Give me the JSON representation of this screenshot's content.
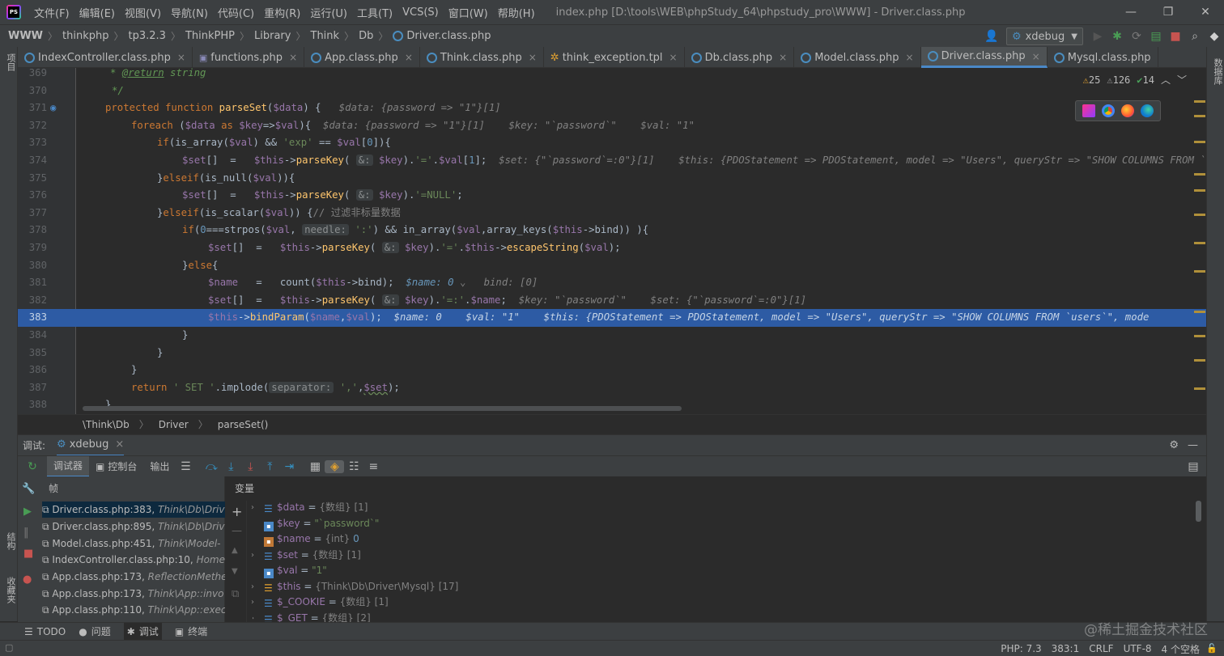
{
  "menubar": {
    "items": [
      "文件(F)",
      "编辑(E)",
      "视图(V)",
      "导航(N)",
      "代码(C)",
      "重构(R)",
      "运行(U)",
      "工具(T)",
      "VCS(S)",
      "窗口(W)",
      "帮助(H)"
    ],
    "window_title": "index.php [D:\\tools\\WEB\\phpStudy_64\\phpstudy_pro\\WWW] - Driver.class.php"
  },
  "navbar": {
    "breadcrumbs": [
      "WWW",
      "thinkphp",
      "tp3.2.3",
      "ThinkPHP",
      "Library",
      "Think",
      "Db",
      "Driver.class.php"
    ],
    "run_config": "xdebug"
  },
  "left_strip": {
    "project": "项目",
    "structure": "结构",
    "favorites": "收藏夹"
  },
  "right_strip": {
    "database": "数据库"
  },
  "tabs": [
    {
      "label": "IndexController.class.php"
    },
    {
      "label": "functions.php"
    },
    {
      "label": "App.class.php"
    },
    {
      "label": "Think.class.php"
    },
    {
      "label": "think_exception.tpl"
    },
    {
      "label": "Db.class.php"
    },
    {
      "label": "Model.class.php"
    },
    {
      "label": "Driver.class.php",
      "active": true
    },
    {
      "label": "Mysql.class.php"
    }
  ],
  "inspections": {
    "warnings": "25",
    "weak_warnings": "126",
    "typos": "14"
  },
  "code": {
    "lines": [
      {
        "num": "369"
      },
      {
        "num": "370"
      },
      {
        "num": "371"
      },
      {
        "num": "372"
      },
      {
        "num": "373"
      },
      {
        "num": "374"
      },
      {
        "num": "375"
      },
      {
        "num": "376"
      },
      {
        "num": "377"
      },
      {
        "num": "378"
      },
      {
        "num": "379"
      },
      {
        "num": "380"
      },
      {
        "num": "381"
      },
      {
        "num": "382"
      },
      {
        "num": "383"
      },
      {
        "num": "384"
      },
      {
        "num": "385"
      },
      {
        "num": "386"
      },
      {
        "num": "387"
      },
      {
        "num": "388"
      }
    ],
    "text": {
      "l369_a": "* ",
      "l369_b": "@return",
      " l369_c": " string",
      "l370": "*/",
      "l371_kw": "protected function ",
      "l371_fn": "parseSet",
      "l371_a": "(",
      "l371_v": "$data",
      "l371_b": ") {",
      "l371_h": "$data: {password => \"1\"}[1]",
      "l372_kw": "foreach ",
      "l372_a": "(",
      "l372_v1": "$data ",
      "l372_as": "as ",
      "l372_v2": "$key",
      "l372_b": "=>",
      "l372_v3": "$val",
      "l372_c": "){",
      "l372_h": "$data: {password => \"1\"}[1]    $key: \"`password`\"    $val: \"1\"",
      "l373_kw": "if",
      "l373_a": "(is_array(",
      "l373_v": "$val",
      "l373_b": ") && ",
      "l373_s": "'exp'",
      "l373_c": " == ",
      "l373_v2": "$val",
      "l373_d": "[",
      "l373_n": "0",
      "l373_e": "]){",
      "l374_v": "$set",
      "l374_a": "[]  =   ",
      "l374_v2": "$this",
      "l374_b": "->",
      "l374_fn": "parseKey",
      "l374_c": "( ",
      "l374_inlay": "&:",
      "l374_v3": "$key",
      ".": ".",
      "l374_d": ").",
      "l374_s": "'='",
      ".2": ".",
      "l374_v4": "$val",
      "l374_e": "[",
      "l374_n": "1",
      "l374_f": "];",
      "l374_h": "$set: {\"`password`=:0\"}[1]    $this: {PDOStatement => PDOStatement, model => \"Users\", queryStr => \"SHOW COLUMNS FROM `users`\", mode",
      "l375_a": "}",
      "l375_kw": "elseif",
      "l375_b": "(is_null(",
      "l375_v": "$val",
      "l375_c": ")){",
      "l376_s": "'=NULL'",
      "l377_kw": "elseif",
      "l377_b": "(is_scalar(",
      "l377_c": ")) {",
      "l377_cm": "// 过滤非标量数据",
      "l378_kw": "if",
      "l378_a": "(",
      "l378_n": "0",
      "l378_b": "===strpos(",
      "l378_c": ", ",
      "l378_inlay": "needle:",
      "l378_s": "':'",
      "l378_d": ") && in_array(",
      "l378_e": ",array_keys(",
      "l378_f": "->bind)) ){",
      "l379_fn": "escapeString",
      "l379_end": ");",
      "l380_a": "}",
      "l380_kw": "else",
      "l380_b": "{",
      "l381_v": "$name",
      "l381_a": "   =   count(",
      "l381_b": "->bind);",
      "l381_h1": "$name: 0",
      "l381_h2": "bind: [0]",
      "l382_s": "'=:'",
      "l382_h": "$key: \"`password`\"    $set: {\"`password`=:0\"}[1]",
      "l383_fn": "bindParam",
      "l383_a": "(",
      "l383_b": ",",
      "l383_c": ");",
      "l383_h": "$name: 0    $val: \"1\"    $this: {PDOStatement => PDOStatement, model => \"Users\", queryStr => \"SHOW COLUMNS FROM `users`\", mode",
      "l384": "}",
      "l385": "}",
      "l386": "}",
      "l387_kw": "return ",
      "l387_s1": "' SET '",
      "l387_a": ".implode(",
      "l387_inlay": "separator:",
      "l387_s2": "','",
      "l387_b": ",",
      "l387_v": "$set",
      "l387_c": ");",
      "l388": "}"
    }
  },
  "editor_breadcrumb": [
    "\\Think\\Db",
    "Driver",
    "parseSet()"
  ],
  "debug": {
    "label": "调试:",
    "session": "xdebug",
    "tabs": [
      "调试器",
      "控制台",
      "输出"
    ],
    "frames_header": "帧",
    "variables_header": "变量",
    "frames": [
      {
        "file": "Driver.class.php:383, ",
        "ns": "Think\\Db\\Drive"
      },
      {
        "file": "Driver.class.php:895, ",
        "ns": "Think\\Db\\Drive"
      },
      {
        "file": "Model.class.php:451, ",
        "ns": "Think\\Model-"
      },
      {
        "file": "IndexController.class.php:10, ",
        "ns": "Home"
      },
      {
        "file": "App.class.php:173, ",
        "ns": "ReflectionMethe"
      },
      {
        "file": "App.class.php:173, ",
        "ns": "Think\\App::invo"
      },
      {
        "file": "App.class.php:110, ",
        "ns": "Think\\App::exec"
      }
    ],
    "variables": [
      {
        "name": "$data",
        "eq": " = ",
        "type": "{数组} [1]",
        "val": ""
      },
      {
        "name": "$key",
        "eq": " = ",
        "type": "",
        "val": "\"`password`\""
      },
      {
        "name": "$name",
        "eq": " = ",
        "type": "{int} ",
        "val": "0"
      },
      {
        "name": "$set",
        "eq": " = ",
        "type": "{数组} [1]",
        "val": ""
      },
      {
        "name": "$val",
        "eq": " = ",
        "type": "",
        "val": "\"1\""
      },
      {
        "name": "$this",
        "eq": " = ",
        "type": "{Think\\Db\\Driver\\Mysql} [17]",
        "val": ""
      },
      {
        "name": "$_COOKIE",
        "eq": " = ",
        "type": "{数组} [1]",
        "val": ""
      },
      {
        "name": "$_GET",
        "eq": " = ",
        "type": "{数组} [2]",
        "val": ""
      }
    ]
  },
  "bottom_tools": [
    "TODO",
    "问题",
    "调试",
    "终端"
  ],
  "status": {
    "php": "PHP: 7.3",
    "pos": "383:1",
    "eol": "CRLF",
    "enc": "UTF-8",
    "indent": "4 个空格"
  },
  "watermark": "@稀土掘金技术社区"
}
